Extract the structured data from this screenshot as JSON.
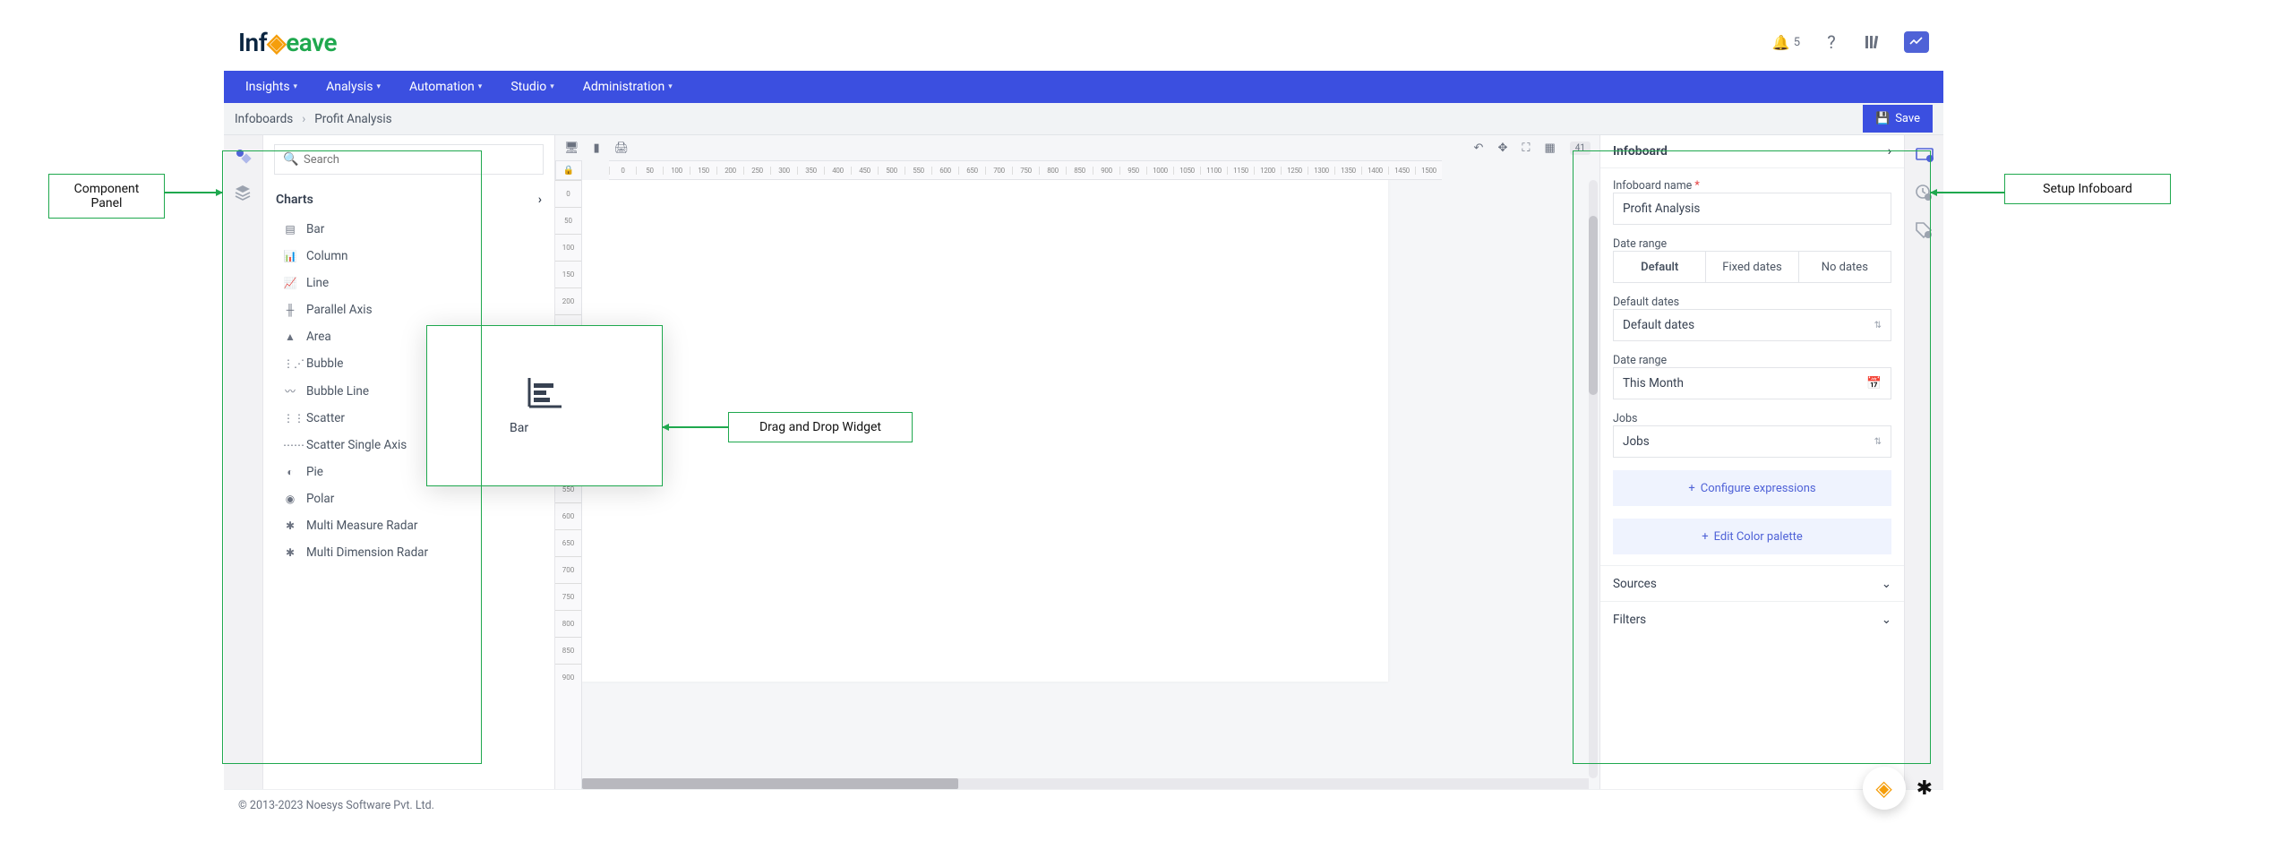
{
  "header": {
    "logo_info": "Inf",
    "logo_weave": "eave",
    "notif_count": "5"
  },
  "nav": {
    "items": [
      "Insights",
      "Analysis",
      "Automation",
      "Studio",
      "Administration"
    ]
  },
  "breadcrumb": {
    "root": "Infoboards",
    "current": "Profit Analysis"
  },
  "save_label": "Save",
  "search": {
    "placeholder": "Search"
  },
  "component_panel": {
    "category": "Charts",
    "items": [
      "Bar",
      "Column",
      "Line",
      "Parallel Axis",
      "Area",
      "Bubble",
      "Bubble Line",
      "Scatter",
      "Scatter Single Axis",
      "Pie",
      "Polar",
      "Multi Measure Radar",
      "Multi Dimension Radar"
    ]
  },
  "drag_widget": {
    "label": "Bar"
  },
  "canvas": {
    "zoom_label": "41"
  },
  "setup": {
    "title": "Infoboard",
    "name_label": "Infoboard name",
    "name_value": "Profit Analysis",
    "date_range_label": "Date range",
    "seg_default": "Default",
    "seg_fixed": "Fixed dates",
    "seg_none": "No dates",
    "default_dates_label": "Default dates",
    "default_dates_value": "Default dates",
    "date_range_value": "This Month",
    "jobs_label": "Jobs",
    "jobs_value": "Jobs",
    "configure_label": "Configure expressions",
    "palette_label": "Edit Color palette",
    "sources_label": "Sources",
    "filters_label": "Filters"
  },
  "footer": {
    "copyright": "© 2013-2023 Noesys Software Pvt. Ltd."
  },
  "callouts": {
    "left": "Component Panel",
    "mid": "Drag and Drop Widget",
    "right": "Setup Infoboard"
  }
}
